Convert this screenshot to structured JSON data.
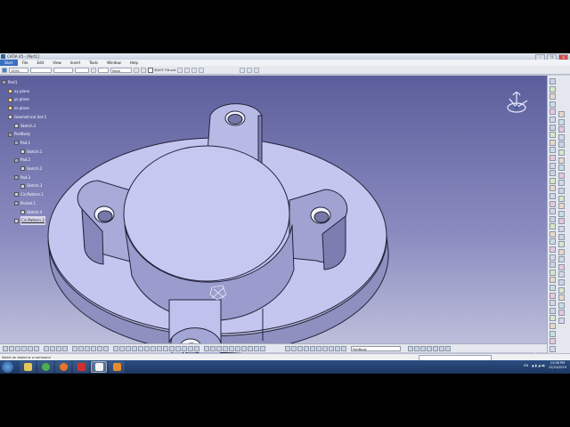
{
  "window": {
    "title": "CATIA V5 - [Part1]",
    "controls": [
      "–",
      "❐",
      "✕"
    ]
  },
  "menu": {
    "items": [
      "Start",
      "File",
      "Edit",
      "View",
      "Insert",
      "Tools",
      "Window",
      "Help"
    ],
    "active_index": 0
  },
  "toolbar_top": {
    "zoom_value": "100%",
    "style_value": "",
    "font_value": "",
    "layer_value": "None",
    "checkbox_label": "3D/CE Tilt-out"
  },
  "tree": [
    {
      "label": "Part1",
      "icon": "part-icon",
      "level": 0
    },
    {
      "label": "xy plane",
      "icon": "plane-icon",
      "level": 1
    },
    {
      "label": "yz plane",
      "icon": "plane-icon",
      "level": 1
    },
    {
      "label": "zx plane",
      "icon": "plane-icon",
      "level": 1
    },
    {
      "label": "Geometrical Set.1",
      "icon": "geoset-icon",
      "level": 1
    },
    {
      "label": "Sketch.1",
      "icon": "sketch-icon",
      "level": 2
    },
    {
      "label": "PartBody",
      "icon": "body-icon",
      "level": 1
    },
    {
      "label": "Pad.1",
      "icon": "pad-icon",
      "level": 2
    },
    {
      "label": "Sketch.1",
      "icon": "sketch-icon",
      "level": 3
    },
    {
      "label": "Pad.2",
      "icon": "pad-icon",
      "level": 2
    },
    {
      "label": "Sketch.2",
      "icon": "sketch-icon",
      "level": 3
    },
    {
      "label": "Pad.3",
      "icon": "pad-icon",
      "level": 2
    },
    {
      "label": "Sketch.3",
      "icon": "sketch-icon",
      "level": 3
    },
    {
      "label": "CircPattern.1",
      "icon": "pattern-icon",
      "level": 2
    },
    {
      "label": "Pocket.1",
      "icon": "pocket-icon",
      "level": 2
    },
    {
      "label": "Sketch.4",
      "icon": "sketch-icon",
      "level": 3
    },
    {
      "label": "CircPattern.2",
      "icon": "pattern-icon",
      "level": 2,
      "highlighted": true
    }
  ],
  "bottom_toolbar": {
    "body_select": "PartBody"
  },
  "status": {
    "message": "Select an object or a command"
  },
  "taskbar": {
    "apps": [
      "explorer-icon",
      "chrome-icon",
      "firefox-icon",
      "acrobat-icon",
      "catia-icon",
      "recorder-icon"
    ],
    "active_index": 4,
    "lang": "EN",
    "time": "12:08 PM",
    "date": "12/24/2019"
  },
  "colors": {
    "part_fill": "#c4c6f0",
    "part_edge": "#23233a",
    "bg_top": "#5c5e9c",
    "bg_bottom": "#c7c8e0",
    "taskbar": "#1f3b66",
    "menu_active": "#3a6fc0"
  }
}
